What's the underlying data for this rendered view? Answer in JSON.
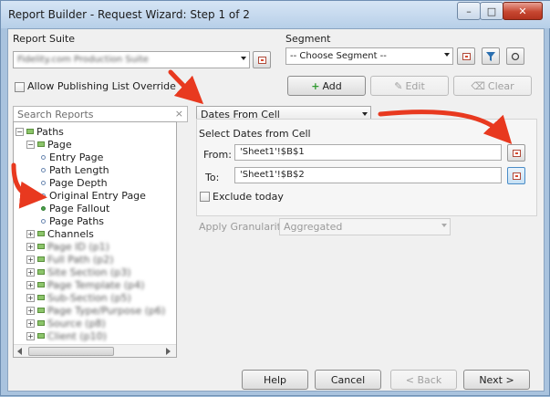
{
  "window": {
    "title": "Report Builder - Request Wizard: Step 1 of 2",
    "minimize": "–",
    "maximize": "□",
    "close": "✕"
  },
  "report_suite": {
    "label": "Report Suite",
    "value": "Fidelity.com Production Suite"
  },
  "segment": {
    "label": "Segment",
    "value": "-- Choose Segment --",
    "add": "Add",
    "edit": "Edit",
    "clear": "Clear"
  },
  "publishing": {
    "label": "Allow Publishing List Override"
  },
  "search": {
    "placeholder": "Search Reports",
    "clear": "×"
  },
  "tree": {
    "paths": "Paths",
    "page": "Page",
    "page_children": [
      "Entry Page",
      "Path Length",
      "Page Depth",
      "Original Entry Page",
      "Page Fallout",
      "Page Paths"
    ],
    "channels": "Channels",
    "channels_children": [
      "Page ID (p1)",
      "Full Path (p2)",
      "Site Section (p3)",
      "Page Template (p4)",
      "Sub-Section (p5)",
      "Page Type/Purpose (p6)",
      "Source (p8)",
      "Client (p10)"
    ]
  },
  "dates": {
    "dropdown": "Dates From Cell",
    "section_label": "Select Dates from Cell",
    "from_label": "From:",
    "from_value": "'Sheet1'!$B$1",
    "to_label": "To:",
    "to_value": "'Sheet1'!$B$2",
    "exclude_today": "Exclude today"
  },
  "granularity": {
    "label": "Apply Granularity",
    "value": "Aggregated"
  },
  "footer": {
    "help": "Help",
    "cancel": "Cancel",
    "back": "< Back",
    "next": "Next >"
  },
  "colors": {
    "arrow": "#e8391f",
    "accent": "#3c7fb1"
  }
}
